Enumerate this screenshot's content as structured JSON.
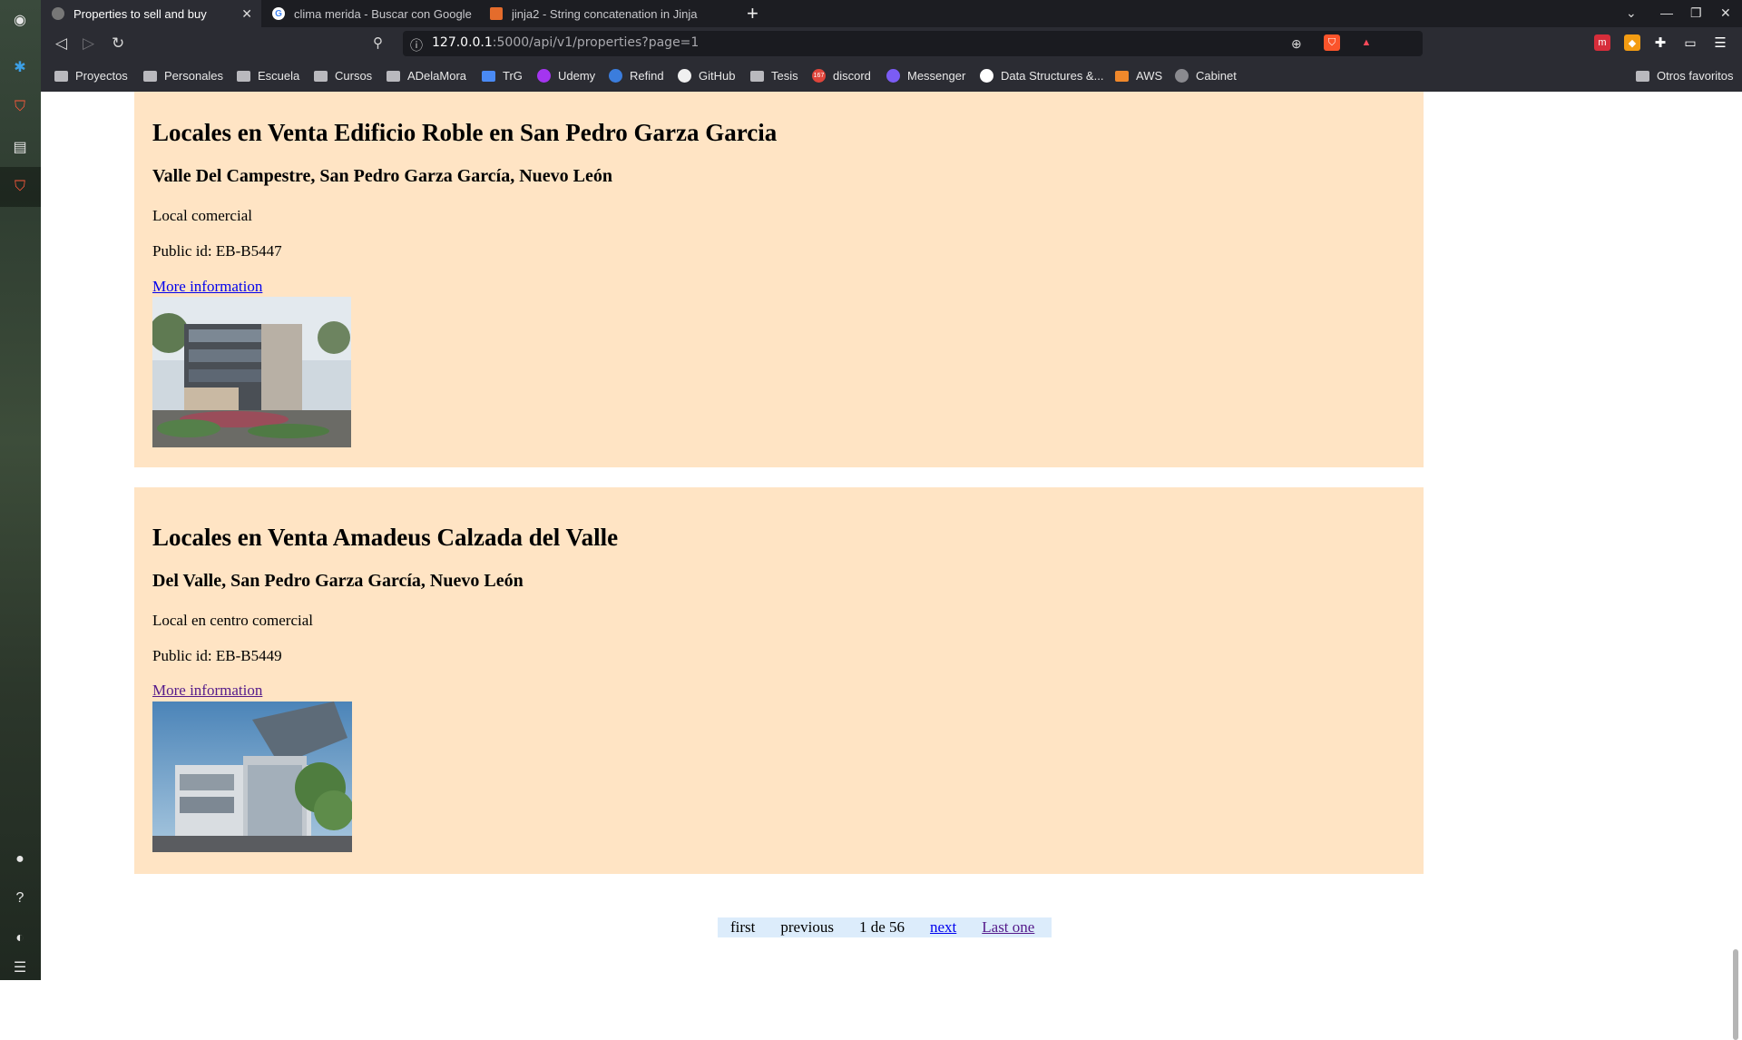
{
  "browser": {
    "tabs": [
      {
        "title": "Properties to sell and buy",
        "active": true
      },
      {
        "title": "clima merida - Buscar con Google",
        "active": false
      },
      {
        "title": "jinja2 - String concatenation in Jinja",
        "active": false
      }
    ],
    "url_host": "127.0.0.1",
    "url_rest": ":5000/api/v1/properties?page=1",
    "bookmarks": [
      "Proyectos",
      "Personales",
      "Escuela",
      "Cursos",
      "ADelaMora",
      "TrG",
      "Udemy",
      "Refind",
      "GitHub",
      "Tesis",
      "discord",
      "Messenger",
      "Data Structures &...",
      "AWS",
      "Cabinet"
    ],
    "other_bookmarks": "Otros favoritos",
    "discord_badge": "167"
  },
  "listings": [
    {
      "title": "Locales en Venta Edificio Roble en San Pedro Garza Garcia",
      "location": "Valle Del Campestre, San Pedro Garza García, Nuevo León",
      "type": "Local comercial",
      "public_id": "Public id: EB-B5447",
      "link": "More information"
    },
    {
      "title": "Locales en Venta Amadeus Calzada del Valle",
      "location": "Del Valle, San Pedro Garza García, Nuevo León",
      "type": "Local en centro comercial",
      "public_id": "Public id: EB-B5449",
      "link": "More information"
    }
  ],
  "pagination": {
    "first": "first",
    "previous": "previous",
    "current": "1 de 56",
    "next": "next",
    "last": "Last one"
  },
  "colors": {
    "card_bg": "#ffe4c4",
    "pager_bg": "#dcecfb",
    "link": "#0000ee",
    "visited_link": "#551a8b"
  }
}
